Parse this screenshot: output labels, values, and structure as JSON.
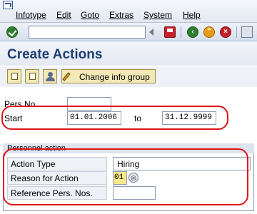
{
  "menu": {
    "items": [
      "Infotype",
      "Edit",
      "Goto",
      "Extras",
      "System",
      "Help"
    ]
  },
  "toolbar": {
    "command_value": ""
  },
  "page": {
    "title": "Create Actions"
  },
  "app_toolbar": {
    "change_info_group_label": "Change info group"
  },
  "form": {
    "pers_no_label": "Pers.No.",
    "pers_no_value": "",
    "start_label": "Start",
    "start_value": "01.01.2006",
    "to_label": "to",
    "end_value": "31.12.9999"
  },
  "personnel_action": {
    "group_title": "Personnel action",
    "action_type_label": "Action Type",
    "action_type_value": "Hiring",
    "reason_label": "Reason for Action",
    "reason_value": "01",
    "ref_pers_label": "Reference Pers. Nos.",
    "ref_pers_value": ""
  },
  "colors": {
    "highlight": "#e0141b",
    "title": "#1e3f74"
  }
}
